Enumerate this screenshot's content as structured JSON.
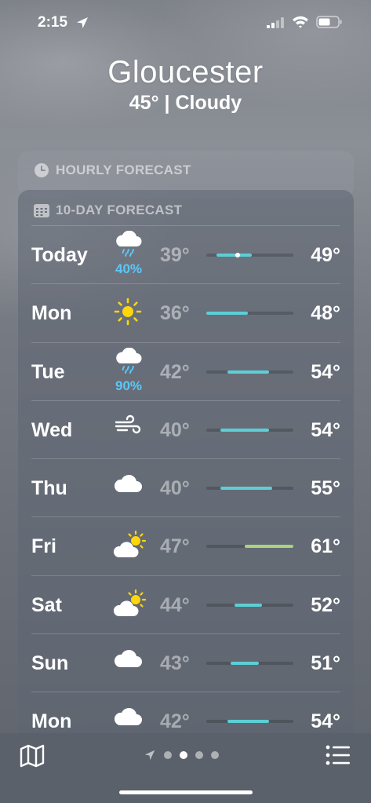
{
  "status_bar": {
    "time": "2:15"
  },
  "header": {
    "city": "Gloucester",
    "summary": "45° | Cloudy"
  },
  "hourly": {
    "title": "HOURLY FORECAST"
  },
  "ten_day": {
    "title": "10-DAY FORECAST",
    "range": {
      "min": 36,
      "max": 61
    },
    "days": [
      {
        "day": "Today",
        "icon": "rain-cloud-icon",
        "precip": "40%",
        "low": "39°",
        "high": "49°",
        "low_val": 39,
        "high_val": 49,
        "current": 45,
        "color": "#5ccfd6"
      },
      {
        "day": "Mon",
        "icon": "sun-icon",
        "precip": "",
        "low": "36°",
        "high": "48°",
        "low_val": 36,
        "high_val": 48,
        "color": "#5ccfd6"
      },
      {
        "day": "Tue",
        "icon": "rain-cloud-icon",
        "precip": "90%",
        "low": "42°",
        "high": "54°",
        "low_val": 42,
        "high_val": 54,
        "color": "#5ccfd6"
      },
      {
        "day": "Wed",
        "icon": "wind-icon",
        "precip": "",
        "low": "40°",
        "high": "54°",
        "low_val": 40,
        "high_val": 54,
        "color": "#5ccfd6"
      },
      {
        "day": "Thu",
        "icon": "cloud-icon",
        "precip": "",
        "low": "40°",
        "high": "55°",
        "low_val": 40,
        "high_val": 55,
        "color": "#5ccfd6"
      },
      {
        "day": "Fri",
        "icon": "partly-sunny-icon",
        "precip": "",
        "low": "47°",
        "high": "61°",
        "low_val": 47,
        "high_val": 61,
        "color": "#a8d47a"
      },
      {
        "day": "Sat",
        "icon": "partly-sunny-icon",
        "precip": "",
        "low": "44°",
        "high": "52°",
        "low_val": 44,
        "high_val": 52,
        "color": "#5ccfd6"
      },
      {
        "day": "Sun",
        "icon": "cloud-icon",
        "precip": "",
        "low": "43°",
        "high": "51°",
        "low_val": 43,
        "high_val": 51,
        "color": "#5ccfd6"
      },
      {
        "day": "Mon",
        "icon": "cloud-icon",
        "precip": "",
        "low": "42°",
        "high": "54°",
        "low_val": 42,
        "high_val": 54,
        "color": "#5ccfd6"
      }
    ]
  },
  "bottom_bar": {
    "pages": 4,
    "active_page": 1
  }
}
